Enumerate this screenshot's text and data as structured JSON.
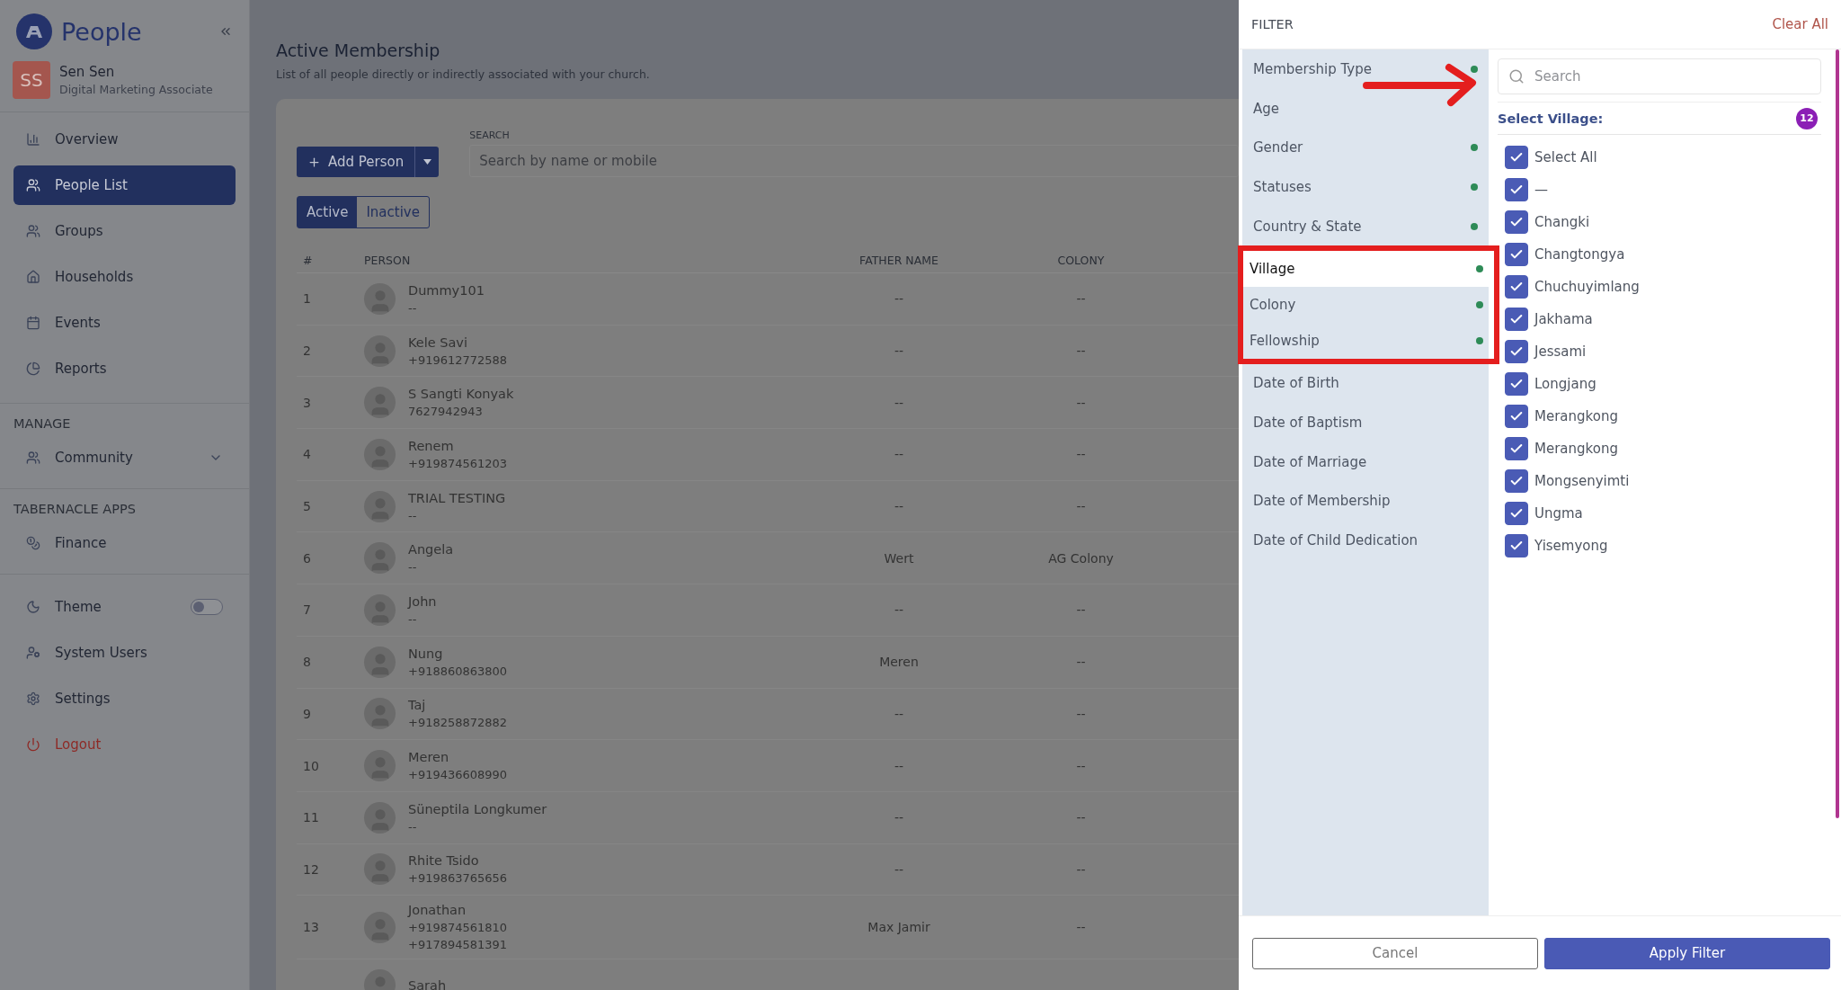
{
  "sidebar": {
    "brand": "People",
    "user": {
      "initials": "SS",
      "name": "Sen Sen",
      "role": "Digital Marketing Associate"
    },
    "nav": [
      {
        "label": "Overview",
        "selected": false
      },
      {
        "label": "People List",
        "selected": true
      },
      {
        "label": "Groups",
        "selected": false
      },
      {
        "label": "Households",
        "selected": false
      },
      {
        "label": "Events",
        "selected": false
      },
      {
        "label": "Reports",
        "selected": false
      }
    ],
    "sections": [
      {
        "heading": "MANAGE",
        "items": [
          {
            "label": "Community",
            "expanded": false
          }
        ]
      },
      {
        "heading": "TABERNACLE APPS",
        "items": [
          {
            "label": "Finance"
          }
        ]
      }
    ],
    "footer": [
      {
        "label": "Theme",
        "kind": "toggle",
        "on": false
      },
      {
        "label": "System Users",
        "kind": "link"
      },
      {
        "label": "Settings",
        "kind": "link"
      },
      {
        "label": "Logout",
        "kind": "danger"
      }
    ]
  },
  "page": {
    "title": "Active Membership",
    "subtitle": "List of all people directly or indirectly associated with your church."
  },
  "toolbar": {
    "add_button": "Add Person",
    "search_label": "SEARCH",
    "search_placeholder": "Search by name or mobile"
  },
  "status_tabs": [
    {
      "label": "Active",
      "selected": true
    },
    {
      "label": "Inactive",
      "selected": false
    }
  ],
  "table": {
    "columns": [
      "#",
      "PERSON",
      "FATHER NAME",
      "COLONY"
    ],
    "rows": [
      {
        "num": "1",
        "name": "Dummy101",
        "phones": [
          "--"
        ],
        "father": "--",
        "colony": "--"
      },
      {
        "num": "2",
        "name": "Kele Savi",
        "phones": [
          "+919612772588"
        ],
        "father": "--",
        "colony": "--"
      },
      {
        "num": "3",
        "name": "S Sangti Konyak",
        "phones": [
          "7627942943"
        ],
        "father": "--",
        "colony": "--"
      },
      {
        "num": "4",
        "name": "Renem",
        "phones": [
          "+919874561203"
        ],
        "father": "--",
        "colony": "--"
      },
      {
        "num": "5",
        "name": "TRIAL TESTING",
        "phones": [
          "--"
        ],
        "father": "--",
        "colony": "--"
      },
      {
        "num": "6",
        "name": "Angela",
        "phones": [
          "--"
        ],
        "father": "Wert",
        "colony": "AG Colony"
      },
      {
        "num": "7",
        "name": "John",
        "phones": [
          "--"
        ],
        "father": "--",
        "colony": "--"
      },
      {
        "num": "8",
        "name": "Nung",
        "phones": [
          "+918860863800"
        ],
        "father": "Meren",
        "colony": "--"
      },
      {
        "num": "9",
        "name": "Taj",
        "phones": [
          "+918258872882"
        ],
        "father": "--",
        "colony": "--"
      },
      {
        "num": "10",
        "name": "Meren",
        "phones": [
          "+919436608990"
        ],
        "father": "--",
        "colony": "--"
      },
      {
        "num": "11",
        "name": "Süneptila Longkumer",
        "phones": [
          "--"
        ],
        "father": "--",
        "colony": "--"
      },
      {
        "num": "12",
        "name": "Rhite Tsido",
        "phones": [
          "+919863765656"
        ],
        "father": "--",
        "colony": "--"
      },
      {
        "num": "13",
        "name": "Jonathan",
        "phones": [
          "+919874561810",
          "+917894581391"
        ],
        "father": "Max Jamir",
        "colony": "--"
      },
      {
        "name": "Sarah"
      }
    ]
  },
  "filter": {
    "title": "FILTER",
    "clear": "Clear All",
    "pointer_arrow": true,
    "categories": [
      {
        "label": "Membership Type",
        "active": true,
        "selected": false,
        "highlighted": false
      },
      {
        "label": "Age",
        "active": false,
        "selected": false,
        "highlighted": false
      },
      {
        "label": "Gender",
        "active": true,
        "selected": false,
        "highlighted": false
      },
      {
        "label": "Statuses",
        "active": true,
        "selected": false,
        "highlighted": false
      },
      {
        "label": "Country & State",
        "active": true,
        "selected": false,
        "highlighted": false
      },
      {
        "label": "Village",
        "active": true,
        "selected": true,
        "highlighted": true
      },
      {
        "label": "Colony",
        "active": true,
        "selected": false,
        "highlighted": true
      },
      {
        "label": "Fellowship",
        "active": true,
        "selected": false,
        "highlighted": true
      },
      {
        "label": "Date of Birth",
        "active": false,
        "selected": false,
        "highlighted": false
      },
      {
        "label": "Date of Baptism",
        "active": false,
        "selected": false,
        "highlighted": false
      },
      {
        "label": "Date of Marriage",
        "active": false,
        "selected": false,
        "highlighted": false
      },
      {
        "label": "Date of Membership",
        "active": false,
        "selected": false,
        "highlighted": false
      },
      {
        "label": "Date of Child Dedication",
        "active": false,
        "selected": false,
        "highlighted": false
      }
    ],
    "search_placeholder": "Search",
    "list_title": "Select Village:",
    "count": "12",
    "options": [
      {
        "label": "Select All",
        "checked": true
      },
      {
        "label": "—",
        "checked": true
      },
      {
        "label": "Changki",
        "checked": true
      },
      {
        "label": "Changtongya",
        "checked": true
      },
      {
        "label": "Chuchuyimlang",
        "checked": true
      },
      {
        "label": "Jakhama",
        "checked": true
      },
      {
        "label": "Jessami",
        "checked": true
      },
      {
        "label": "Longjang",
        "checked": true
      },
      {
        "label": "Merangkong",
        "checked": true
      },
      {
        "label": "Merangkong",
        "checked": true
      },
      {
        "label": "Mongsenyimti",
        "checked": true
      },
      {
        "label": "Ungma",
        "checked": true
      },
      {
        "label": "Yisemyong",
        "checked": true
      }
    ],
    "buttons": [
      {
        "label": "Cancel",
        "kind": "secondary"
      },
      {
        "label": "Apply Filter",
        "kind": "primary"
      }
    ]
  }
}
